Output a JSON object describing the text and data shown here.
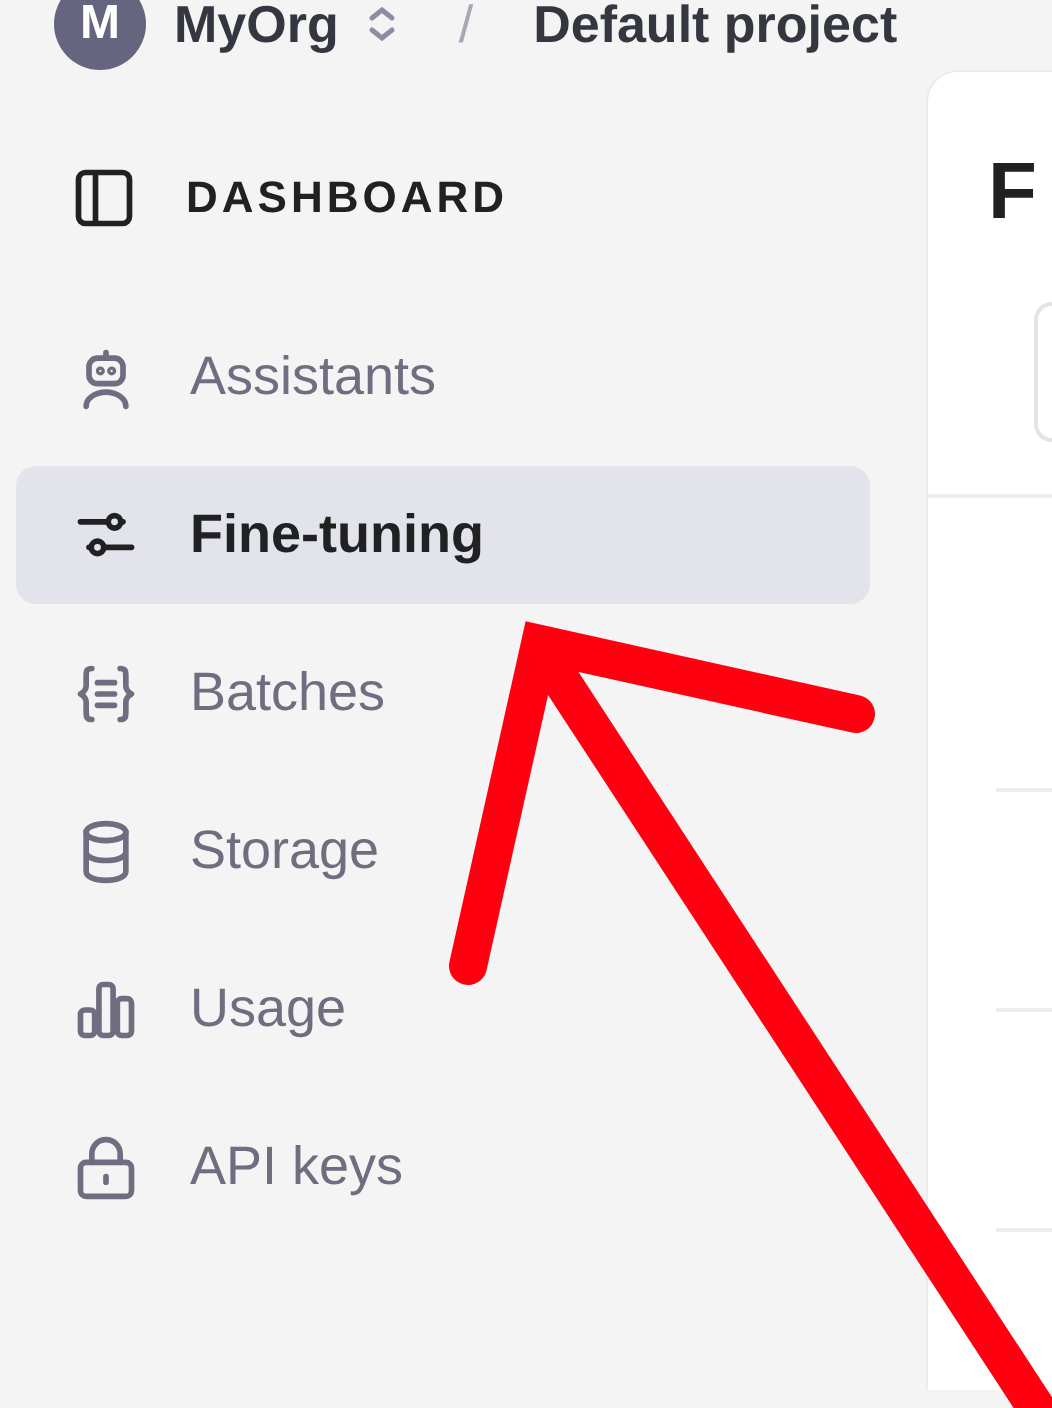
{
  "header": {
    "avatar": "M",
    "org": "MyOrg",
    "separator": "/",
    "project": "Default project"
  },
  "sidebar": {
    "heading": "DASHBOARD",
    "items": [
      {
        "label": "Assistants",
        "selected": false
      },
      {
        "label": "Fine-tuning",
        "selected": true
      },
      {
        "label": "Batches",
        "selected": false
      },
      {
        "label": "Storage",
        "selected": false
      },
      {
        "label": "Usage",
        "selected": false
      },
      {
        "label": "API keys",
        "selected": false
      }
    ]
  },
  "main": {
    "title": "F"
  }
}
